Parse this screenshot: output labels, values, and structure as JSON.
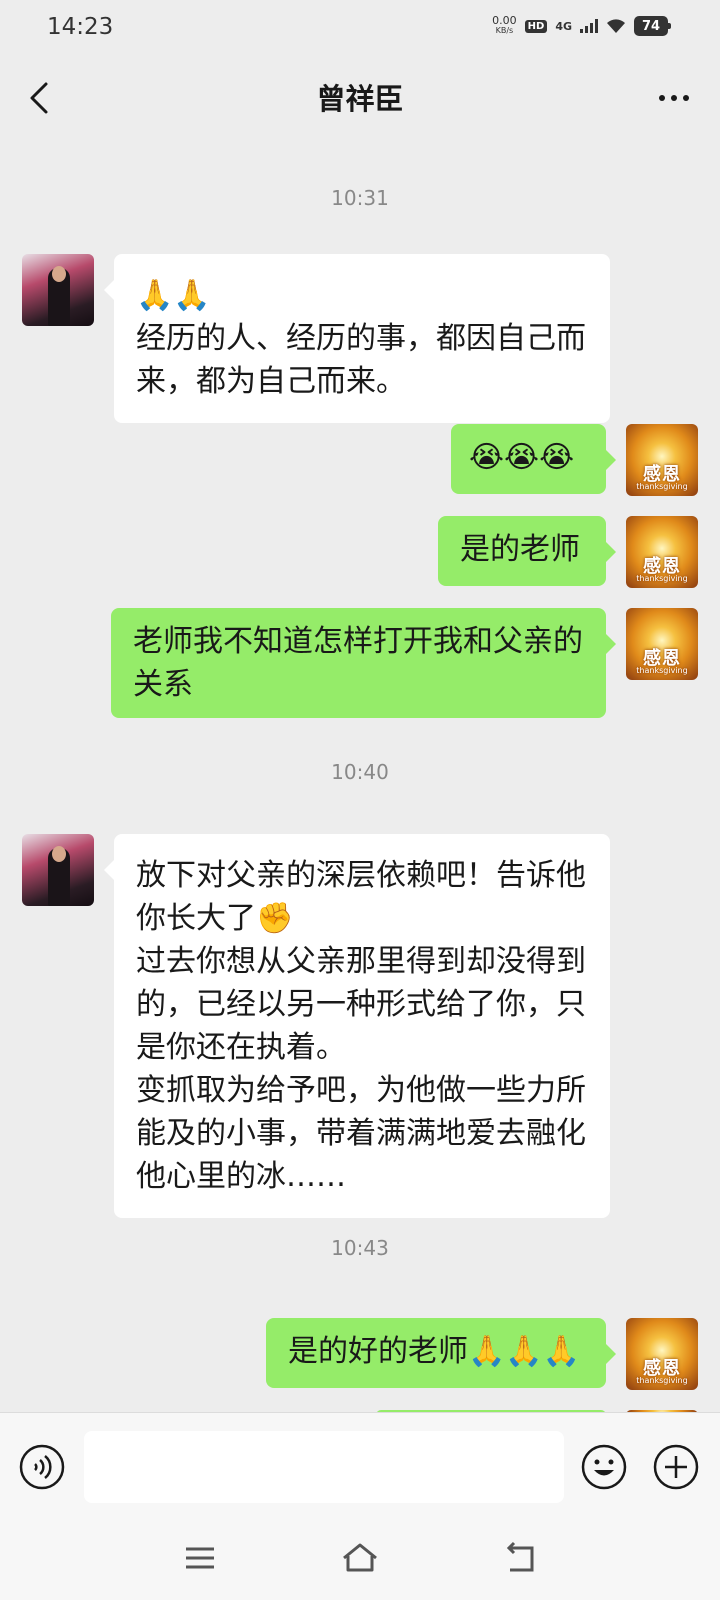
{
  "status_bar": {
    "time": "14:23",
    "net_speed_value": "0.00",
    "net_speed_unit": "KB/s",
    "hd_badge": "HD",
    "network": "4G",
    "battery": "74"
  },
  "header": {
    "title": "曾祥臣"
  },
  "messages": [
    {
      "type": "timestamp",
      "text": "10:31"
    },
    {
      "sender": "teacher",
      "lines": [
        "🙏🙏",
        "经历的人、经历的事，都因自己而",
        "来，都为自己而来。"
      ]
    },
    {
      "sender": "me",
      "lines": [
        "😭😭😭"
      ]
    },
    {
      "sender": "me",
      "lines": [
        "是的老师"
      ]
    },
    {
      "sender": "me",
      "lines": [
        "老师我不知道怎样打开我和父亲的",
        "关系"
      ]
    },
    {
      "type": "timestamp",
      "text": "10:40"
    },
    {
      "sender": "teacher",
      "lines": [
        "放下对父亲的深层依赖吧！告诉他",
        "你长大了✊",
        "过去你想从父亲那里得到却没得到",
        "的，已经以另一种形式给了你，只",
        "是你还在执着。",
        "变抓取为给予吧，为他做一些力所",
        "能及的小事，带着满满地爱去融化",
        "他心里的冰……"
      ]
    },
    {
      "type": "timestamp",
      "text": "10:43"
    },
    {
      "sender": "me",
      "lines": [
        "是的好的老师🙏🙏🙏"
      ]
    }
  ],
  "my_avatar": {
    "text": "感恩",
    "subtext": "thanksgiving"
  },
  "colors": {
    "background": "#ededed",
    "my_bubble": "#95ec69",
    "their_bubble": "#ffffff",
    "timestamp": "#888888"
  },
  "icons": {
    "back": "chevron-left-icon",
    "more": "more-dots-icon",
    "voice": "voice-icon",
    "emoji": "emoji-icon",
    "plus": "plus-icon",
    "nav_menu": "menu-icon",
    "nav_home": "home-icon",
    "nav_back": "back-nav-icon"
  }
}
